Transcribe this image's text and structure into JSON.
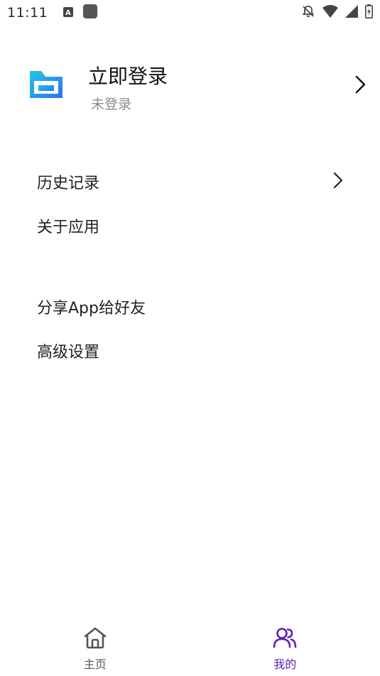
{
  "status_bar": {
    "time": "11:11",
    "left_icons": [
      "font-a-icon",
      "app-square-icon"
    ],
    "right_icons": [
      "bell-off-icon",
      "wifi-icon",
      "signal-icon",
      "battery-icon"
    ]
  },
  "profile": {
    "title": "立即登录",
    "subtitle": "未登录",
    "logo_icon": "folder-logo-icon"
  },
  "menu": {
    "group1": [
      {
        "label": "历史记录",
        "has_chevron": true
      },
      {
        "label": "关于应用",
        "has_chevron": false
      }
    ],
    "group2": [
      {
        "label": "分享App给好友",
        "has_chevron": false
      },
      {
        "label": "高级设置",
        "has_chevron": false
      }
    ]
  },
  "bottom_nav": {
    "tabs": [
      {
        "label": "主页",
        "icon": "home-icon",
        "active": false
      },
      {
        "label": "我的",
        "icon": "users-icon",
        "active": true
      }
    ],
    "active_color": "#5b21b6",
    "inactive_color": "#555555"
  },
  "colors": {
    "logo_gradient_start": "#1fc8e8",
    "logo_gradient_end": "#2f6ff0"
  }
}
